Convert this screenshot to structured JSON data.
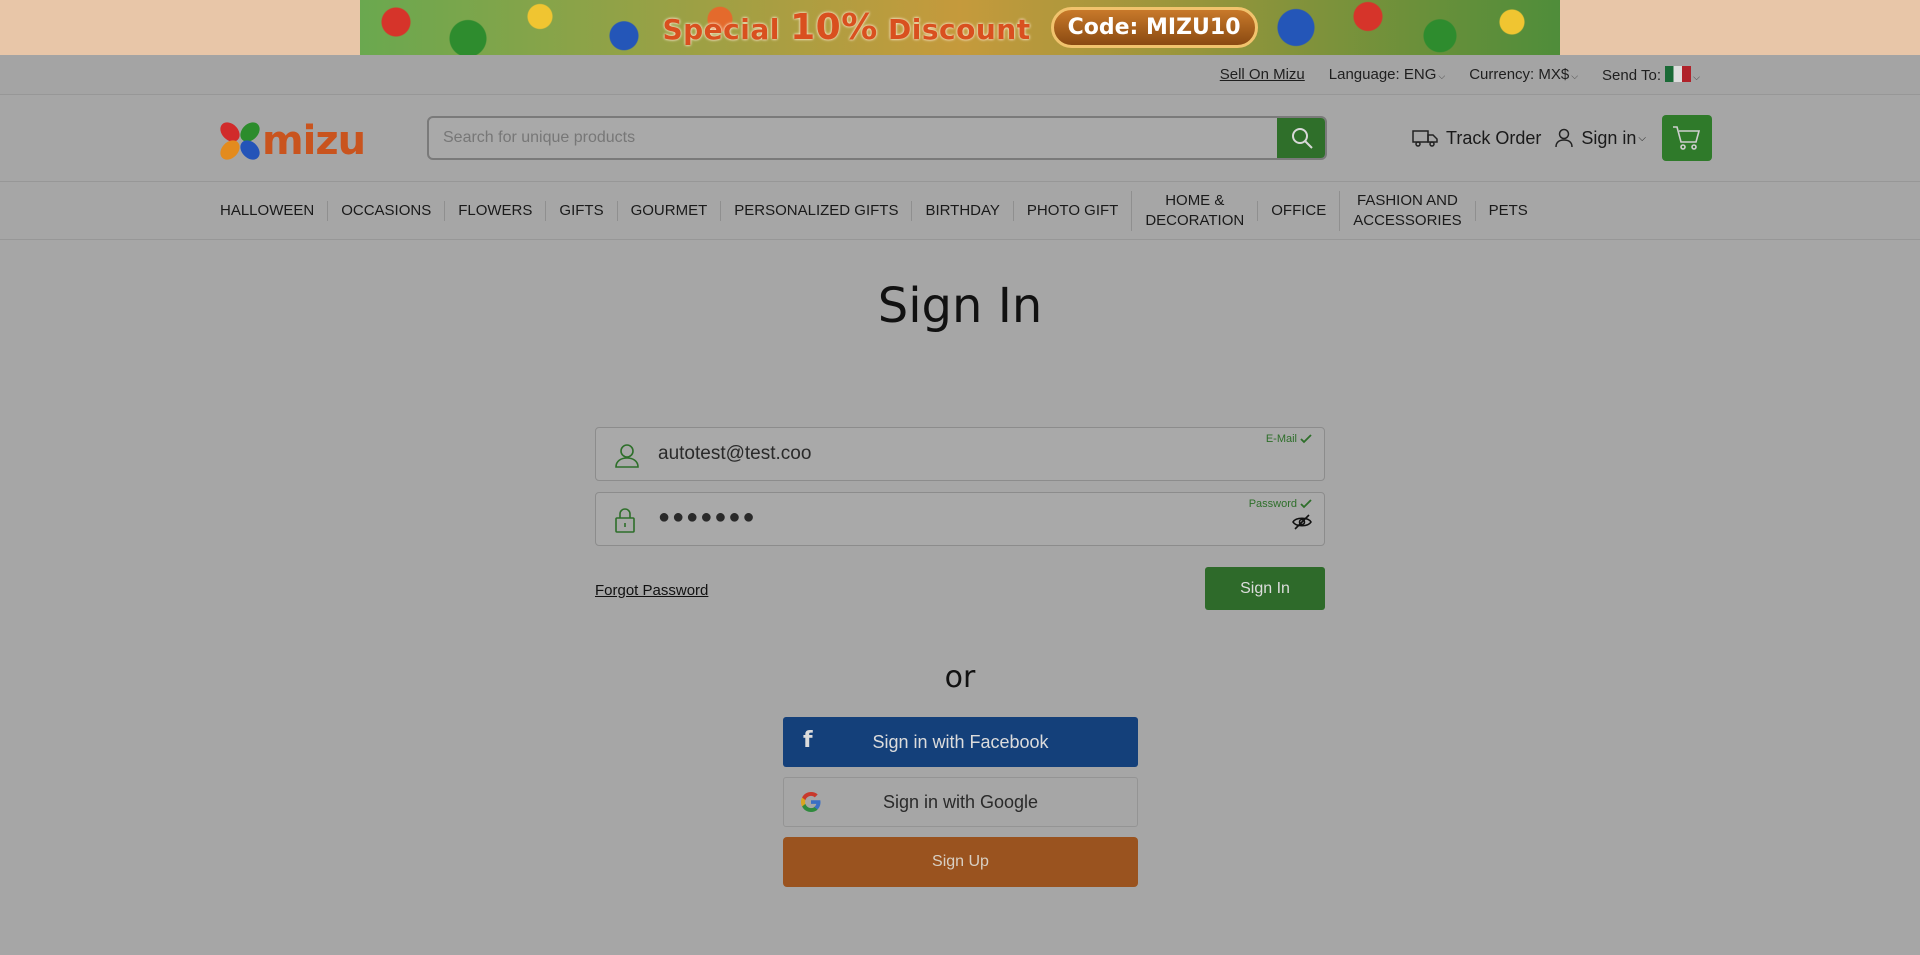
{
  "promo": {
    "text_special": "Special ",
    "text_percent": "10%",
    "text_discount": " Discount",
    "code": "Code: MIZU10"
  },
  "utilbar": {
    "sell": "Sell On Mizu",
    "language": "Language: ENG",
    "currency": "Currency: MX$",
    "send_to": "Send To:"
  },
  "header": {
    "logo_text": "mizu",
    "search_placeholder": "Search for unique products",
    "track_order": "Track Order",
    "sign_in": "Sign in"
  },
  "nav": {
    "items": [
      {
        "label": "HALLOWEEN"
      },
      {
        "label": "OCCASIONS"
      },
      {
        "label": "FLOWERS"
      },
      {
        "label": "GIFTS"
      },
      {
        "label": "GOURMET"
      },
      {
        "label": "PERSONALIZED GIFTS"
      },
      {
        "label": "BIRTHDAY"
      },
      {
        "label": "PHOTO GIFT"
      },
      {
        "label_line1": "HOME &",
        "label_line2": "DECORATION"
      },
      {
        "label": "OFFICE"
      },
      {
        "label_line1": "FASHION AND",
        "label_line2": "ACCESSORIES"
      },
      {
        "label": "PETS"
      }
    ]
  },
  "main": {
    "title": "Sign In",
    "email": {
      "label": "E-Mail",
      "value": "autotest@test.coo"
    },
    "password": {
      "label": "Password",
      "value": "●●●●●●●"
    },
    "forgot": "Forgot Password",
    "signin_button": "Sign In",
    "or": "or",
    "facebook": "Sign in with Facebook",
    "google": "Sign in with Google",
    "signup": "Sign Up"
  },
  "colors": {
    "brand_green": "#2e6a2a",
    "facebook_blue": "#14407a",
    "signup_orange": "#9a531f",
    "logo_orange": "#c9541e"
  }
}
